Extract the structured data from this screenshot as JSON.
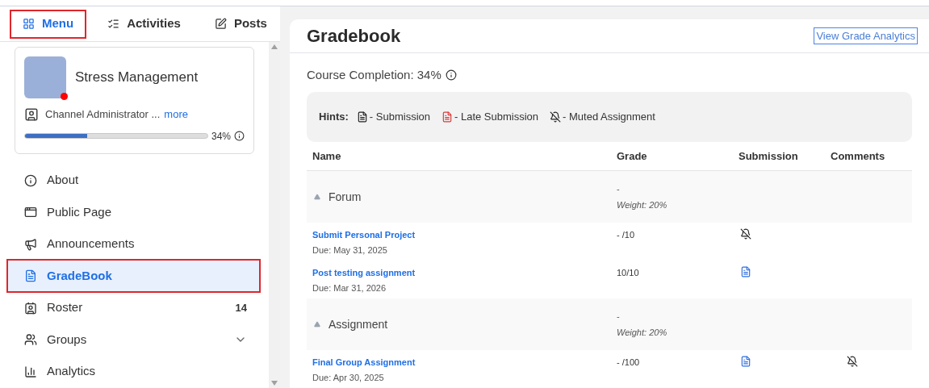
{
  "tabs": [
    {
      "label": "Menu",
      "selected": true,
      "highlighted": true
    },
    {
      "label": "Activities",
      "selected": false,
      "highlighted": false
    },
    {
      "label": "Posts",
      "selected": false,
      "highlighted": false
    }
  ],
  "course": {
    "title": "Stress Management",
    "online": true,
    "role": "Channel Administrator ...",
    "more_link": "more",
    "progress": {
      "level": 0.34,
      "reading": "34%"
    }
  },
  "sidebar": {
    "items": [
      {
        "label": "About",
        "selected": false,
        "highlighted": false
      },
      {
        "label": "Public Page",
        "selected": false,
        "highlighted": false
      },
      {
        "label": "Announcements",
        "selected": false,
        "highlighted": false
      },
      {
        "label": "GradeBook",
        "selected": true,
        "highlighted": true
      },
      {
        "label": "Roster",
        "selected": false,
        "highlighted": false,
        "count": "14"
      },
      {
        "label": "Groups",
        "selected": false,
        "highlighted": false,
        "expandable": true
      },
      {
        "label": "Analytics",
        "selected": false,
        "highlighted": false
      }
    ]
  },
  "page": {
    "title": "Gradebook",
    "analytics_link": "View Grade Analytics",
    "completion": "Course Completion: 34%",
    "hints": {
      "label": "Hints:",
      "items": [
        {
          "kind": "submission",
          "text": "- Submission"
        },
        {
          "kind": "late",
          "text": "- Late Submission"
        },
        {
          "kind": "muted",
          "text": "- Muted Assignment"
        }
      ]
    },
    "table": {
      "columns": [
        "Name",
        "Grade",
        "Submission",
        "Comments"
      ],
      "groups": [
        {
          "name": "Forum",
          "expanded": true,
          "grade": "-",
          "weight": "Weight: 20%",
          "rows": [
            {
              "name": "Submit Personal Project",
              "due": "Due: May 31, 2025",
              "grade": "- /10",
              "submission": {
                "kind": "muted"
              }
            },
            {
              "name": "Post testing assignment",
              "due": "Due: Mar 31, 2026",
              "grade": "10/10",
              "submission": {
                "kind": "submission"
              }
            }
          ]
        },
        {
          "name": "Assignment",
          "expanded": true,
          "grade": "-",
          "weight": "Weight: 20%",
          "rows": [
            {
              "name": "Final Group Assignment",
              "due": "Due: Apr 30, 2025",
              "grade": "- /100",
              "submission": {
                "kind": "submission"
              },
              "comments": {
                "kind": "muted"
              }
            }
          ]
        }
      ]
    }
  }
}
